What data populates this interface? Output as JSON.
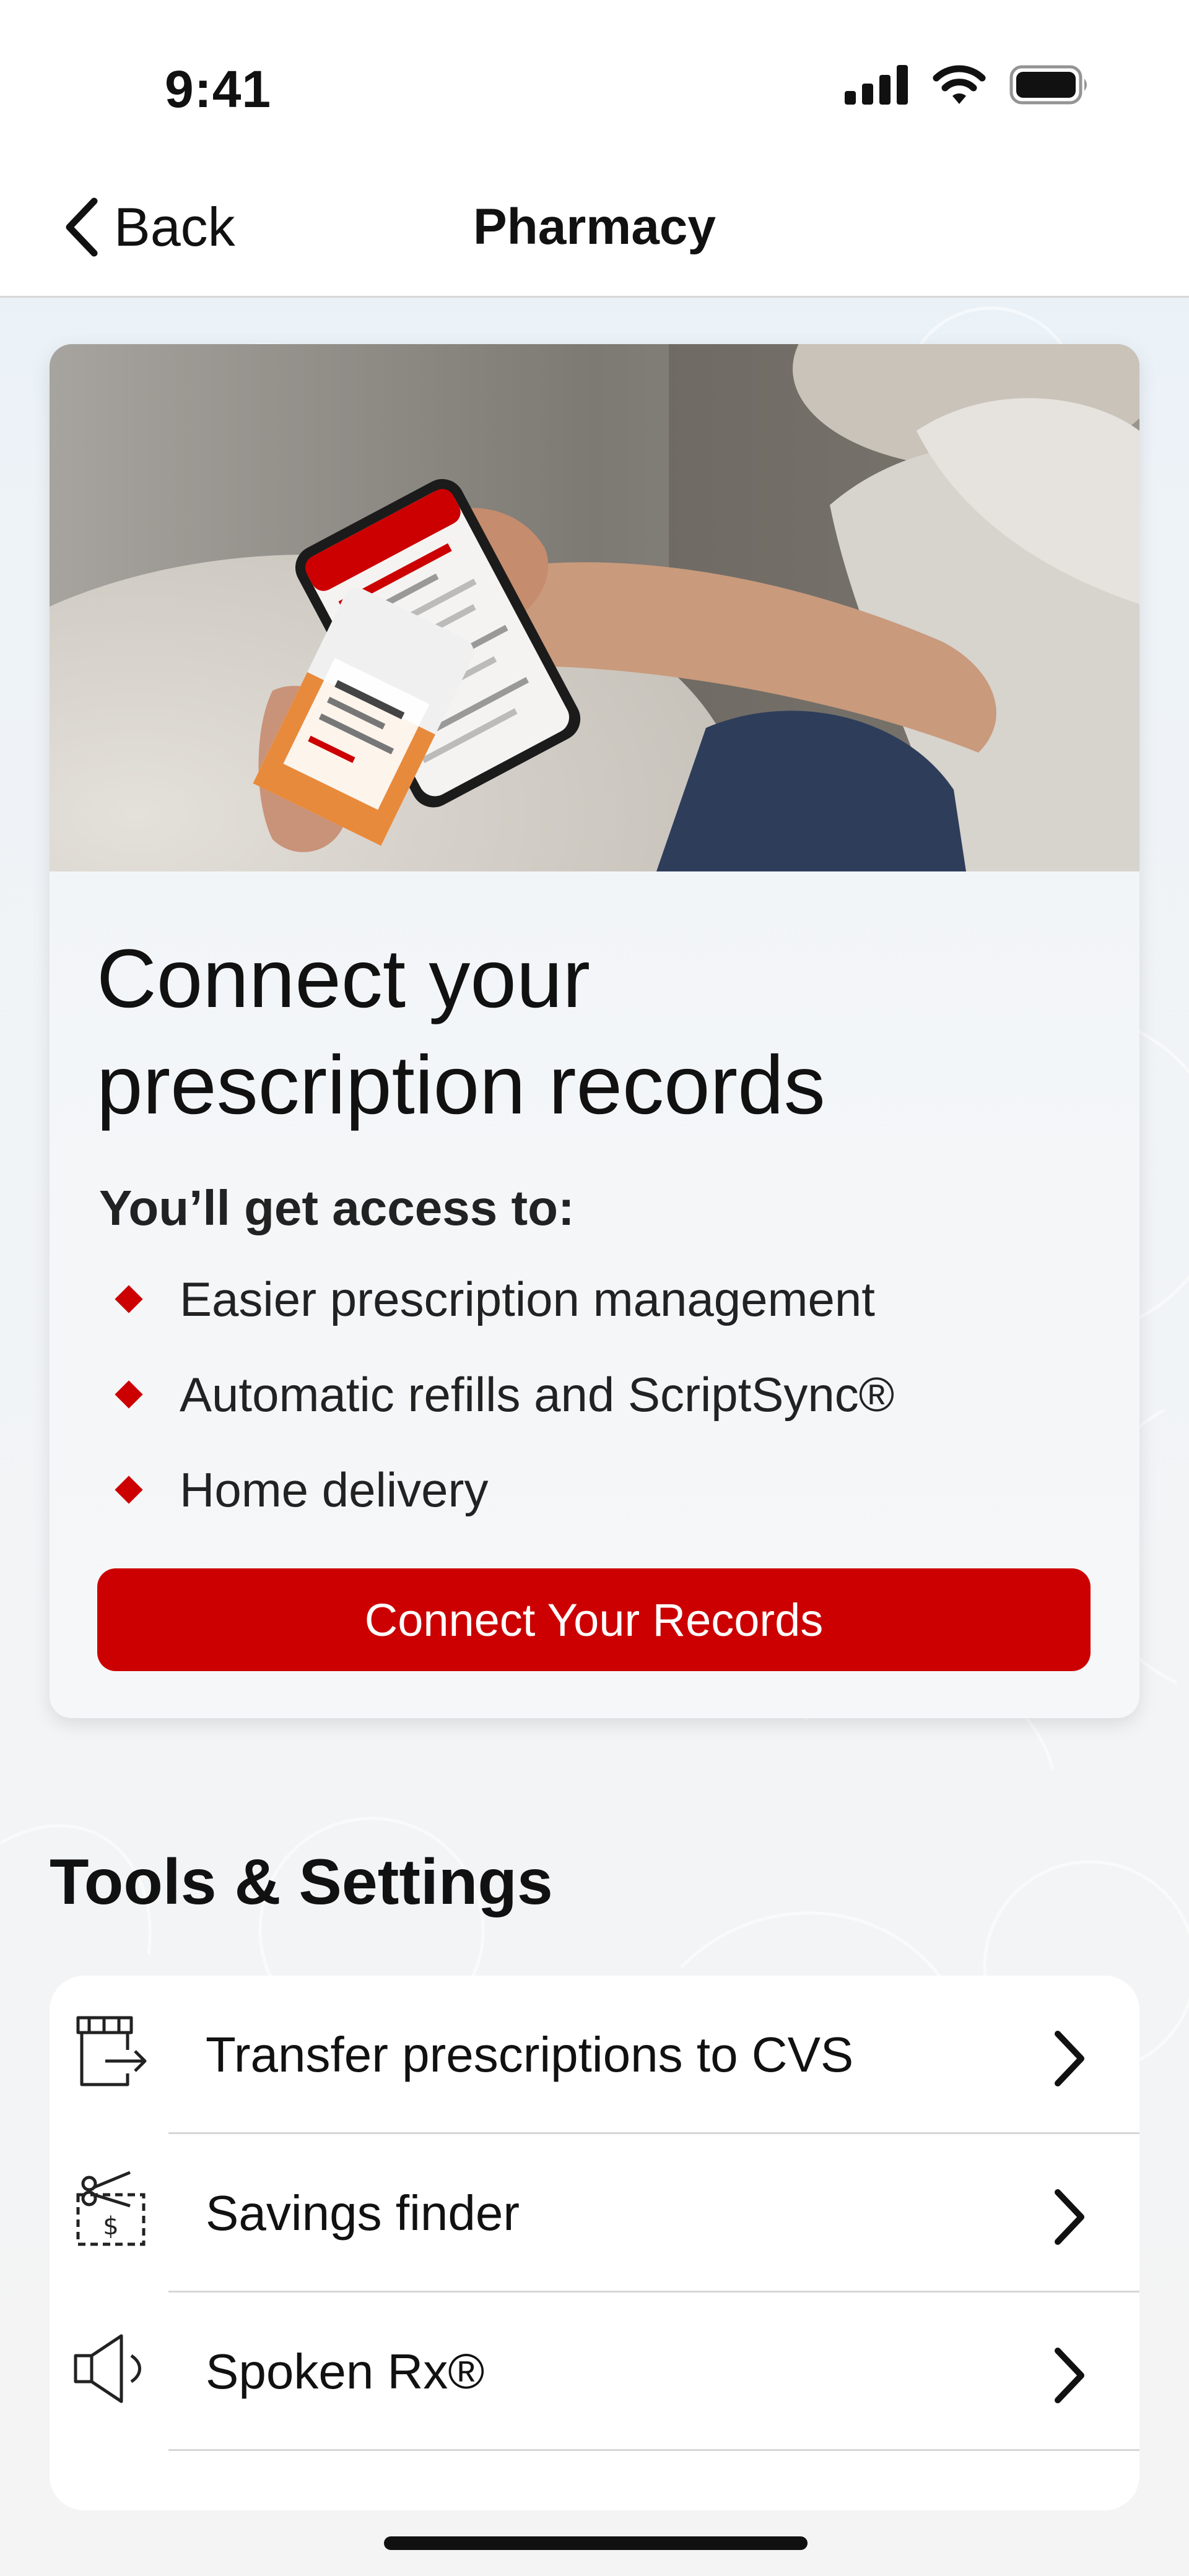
{
  "status_bar": {
    "time": "9:41",
    "icons": [
      "cellular-signal-icon",
      "wifi-icon",
      "battery-icon"
    ]
  },
  "nav": {
    "back_label": "Back",
    "title": "Pharmacy"
  },
  "promo": {
    "image": "person-holding-phone-and-pill-bottle-photo",
    "title_line1": "Connect your",
    "title_line2": "prescription records",
    "access_heading": "You’ll get access to:",
    "benefits": [
      "Easier prescription management",
      "Automatic refills and ScriptSync®",
      "Home delivery"
    ],
    "cta_label": "Connect Your Records"
  },
  "tools": {
    "section_title": "Tools & Settings",
    "items": [
      {
        "label": "Transfer prescriptions to CVS",
        "icon": "transfer-prescription-icon"
      },
      {
        "label": "Savings finder",
        "icon": "coupon-savings-icon"
      },
      {
        "label": "Spoken Rx®",
        "icon": "speaker-icon"
      }
    ]
  },
  "colors": {
    "brand_red": "#cc0000",
    "text": "#111111",
    "background": "#eef3f7"
  }
}
